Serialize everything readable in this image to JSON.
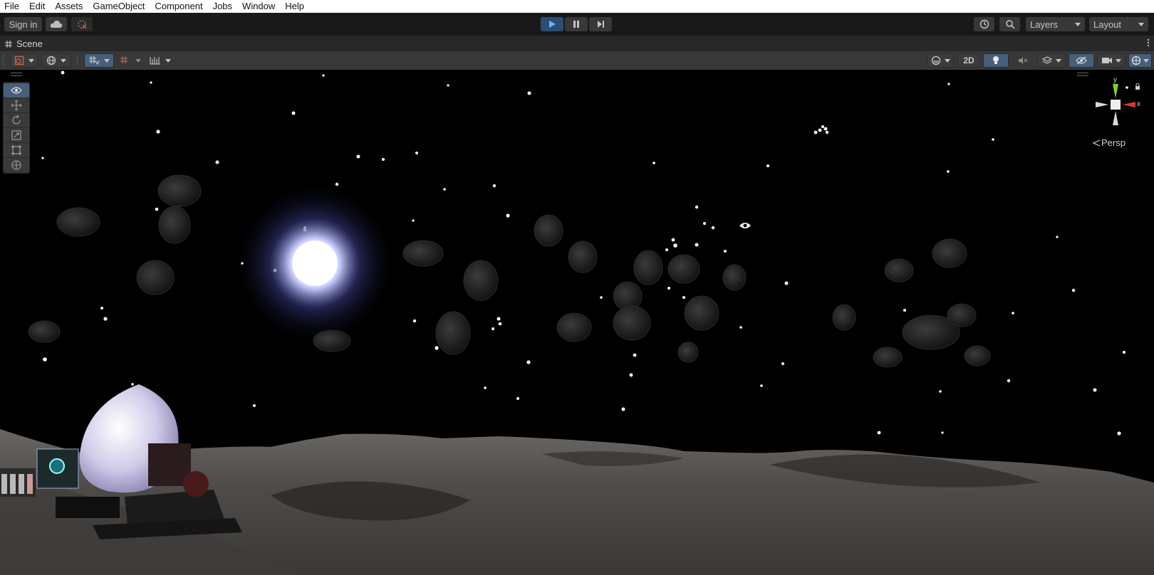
{
  "menu": [
    "File",
    "Edit",
    "Assets",
    "GameObject",
    "Component",
    "Jobs",
    "Window",
    "Help"
  ],
  "toolbar": {
    "sign_in": "Sign in",
    "layers": "Layers",
    "layout": "Layout"
  },
  "scene_tab": {
    "label": "Scene"
  },
  "scene_toolbar": {
    "mode_2d": "2D"
  },
  "gizmo": {
    "y": "y",
    "x": "x",
    "persp": "Persp"
  },
  "colors": {
    "accent": "#46607c",
    "play_blue": "#4c8ed9",
    "gizmo_x": "#d13c2a",
    "gizmo_y": "#86d12a"
  }
}
